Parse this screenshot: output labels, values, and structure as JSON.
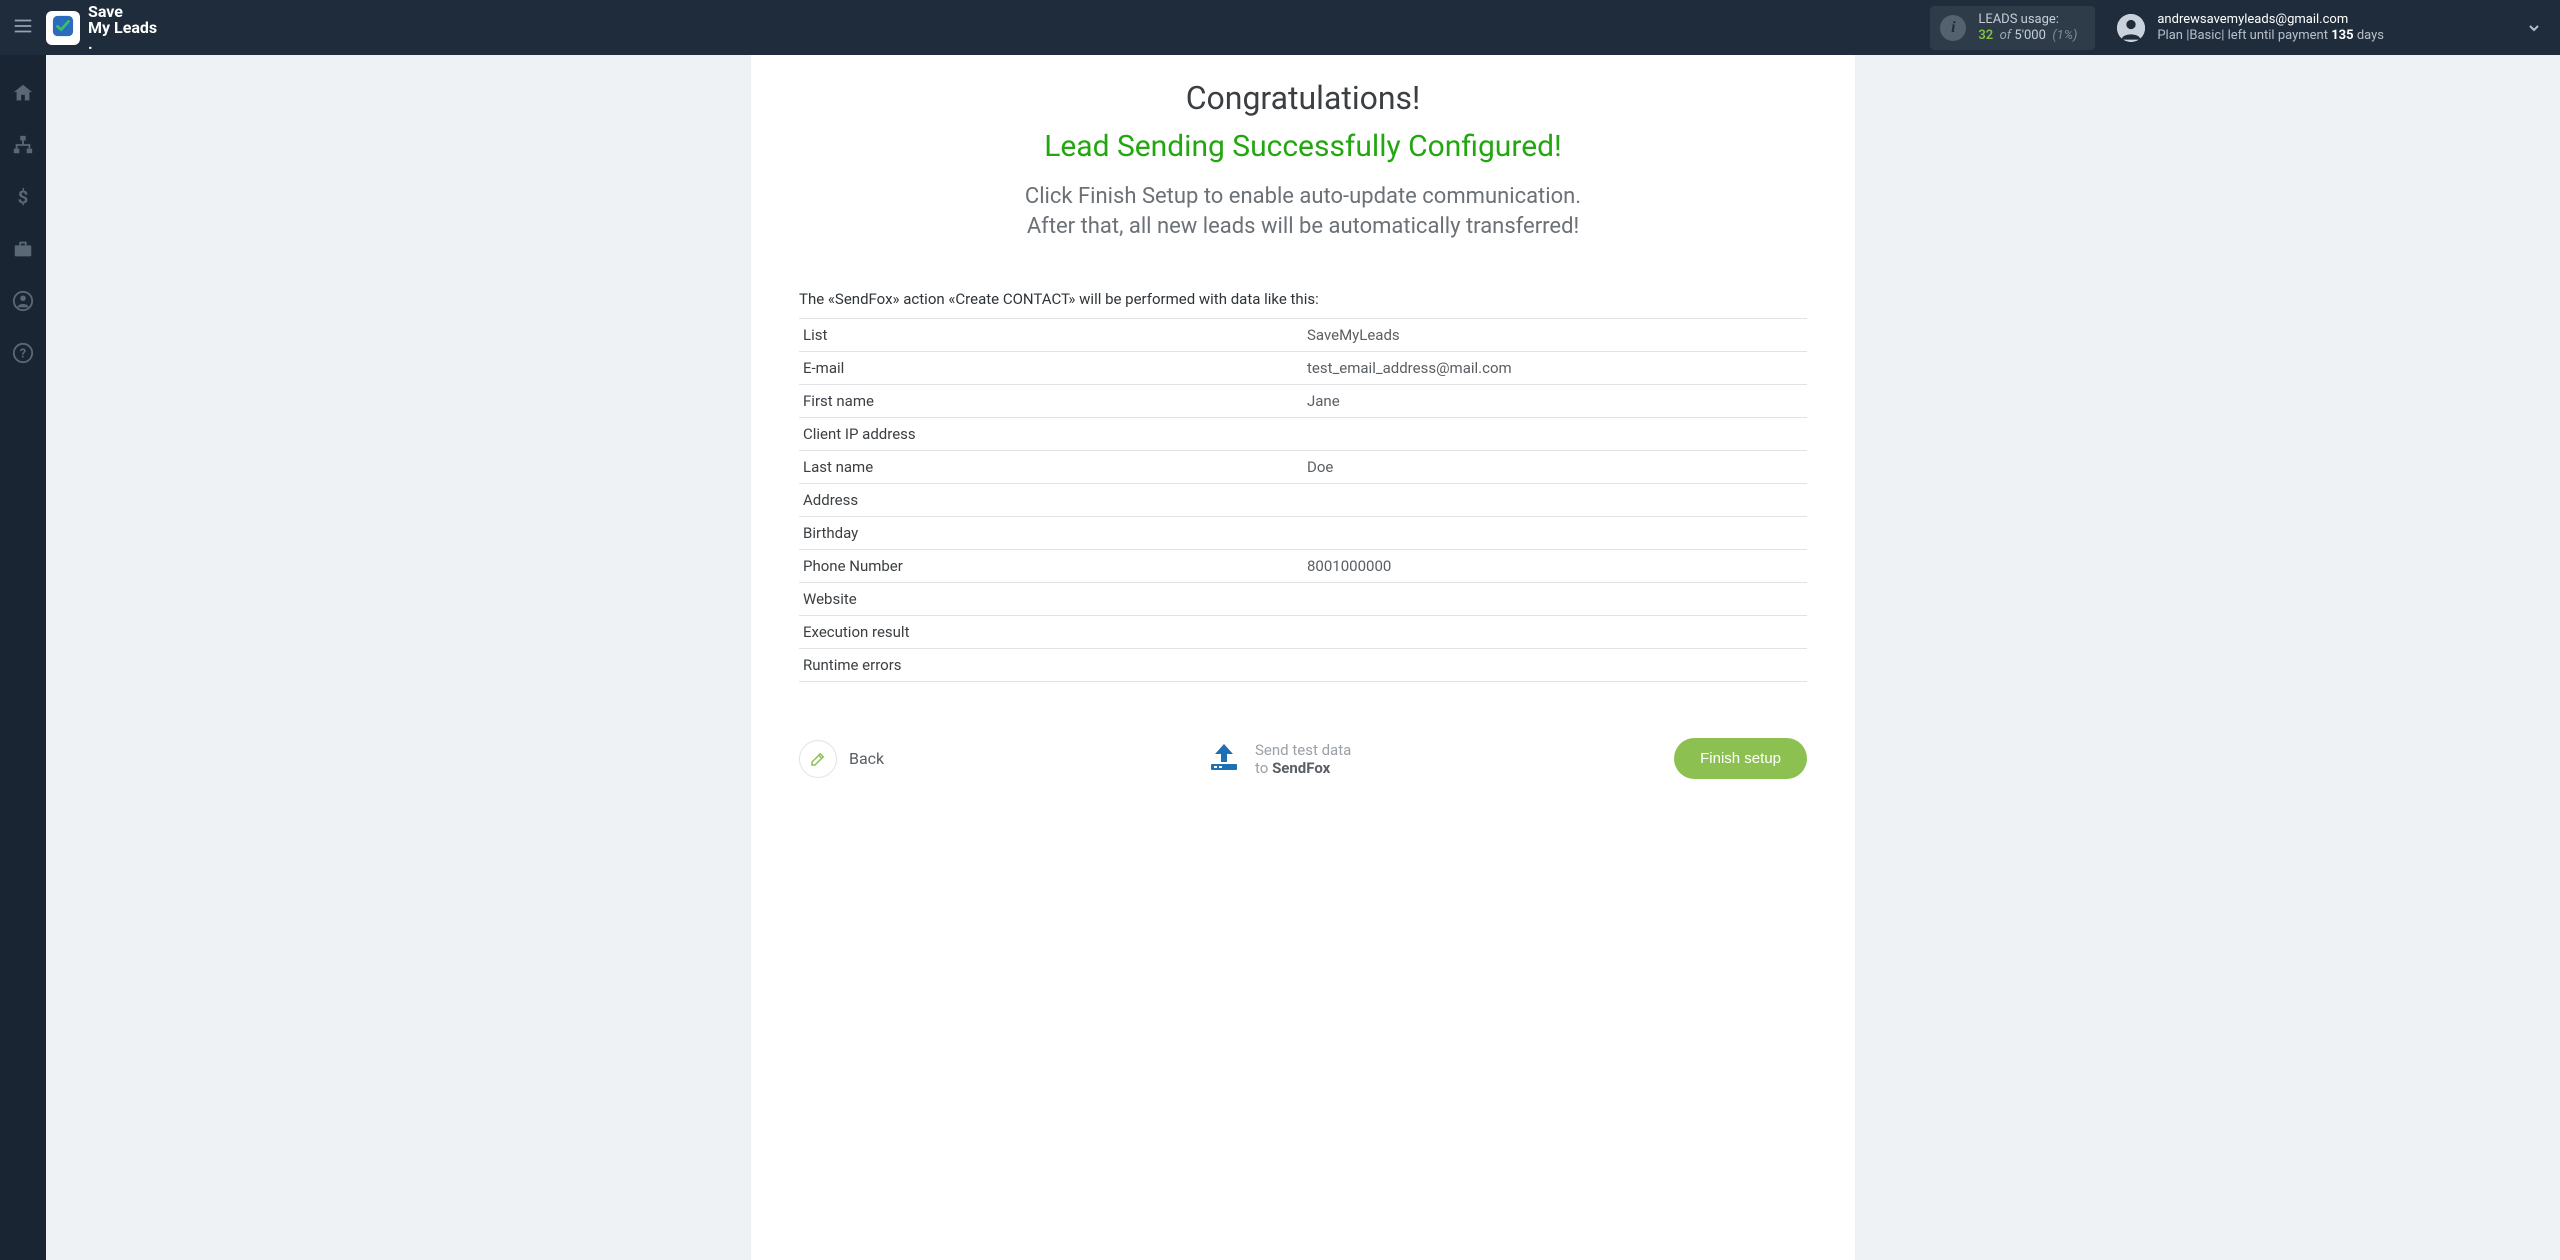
{
  "brand": {
    "line1": "Save",
    "line2": "My Leads"
  },
  "usage": {
    "label": "LEADS usage:",
    "used": "32",
    "of": "of",
    "total": "5'000",
    "pct": "(1%)"
  },
  "account": {
    "email": "andrewsavemyleads@gmail.com",
    "plan_prefix": "Plan |Basic| left until payment ",
    "plan_days": "135",
    "plan_suffix": " days"
  },
  "main": {
    "congrats": "Congratulations!",
    "success": "Lead Sending Successfully Configured!",
    "sub1": "Click Finish Setup to enable auto-update communication.",
    "sub2": "After that, all new leads will be automatically transferred!",
    "preface": "The «SendFox» action «Create CONTACT» will be performed with data like this:",
    "rows": [
      {
        "k": "List",
        "v": "SaveMyLeads"
      },
      {
        "k": "E-mail",
        "v": "test_email_address@mail.com"
      },
      {
        "k": "First name",
        "v": "Jane"
      },
      {
        "k": "Client IP address",
        "v": ""
      },
      {
        "k": "Last name",
        "v": "Doe"
      },
      {
        "k": "Address",
        "v": ""
      },
      {
        "k": "Birthday",
        "v": ""
      },
      {
        "k": "Phone Number",
        "v": "8001000000"
      },
      {
        "k": "Website",
        "v": ""
      },
      {
        "k": "Execution result",
        "v": ""
      },
      {
        "k": "Runtime errors",
        "v": ""
      }
    ]
  },
  "footer": {
    "back": "Back",
    "send_line1": "Send test data",
    "send_line2_prefix": "to ",
    "send_line2_dest": "SendFox",
    "finish": "Finish setup"
  }
}
